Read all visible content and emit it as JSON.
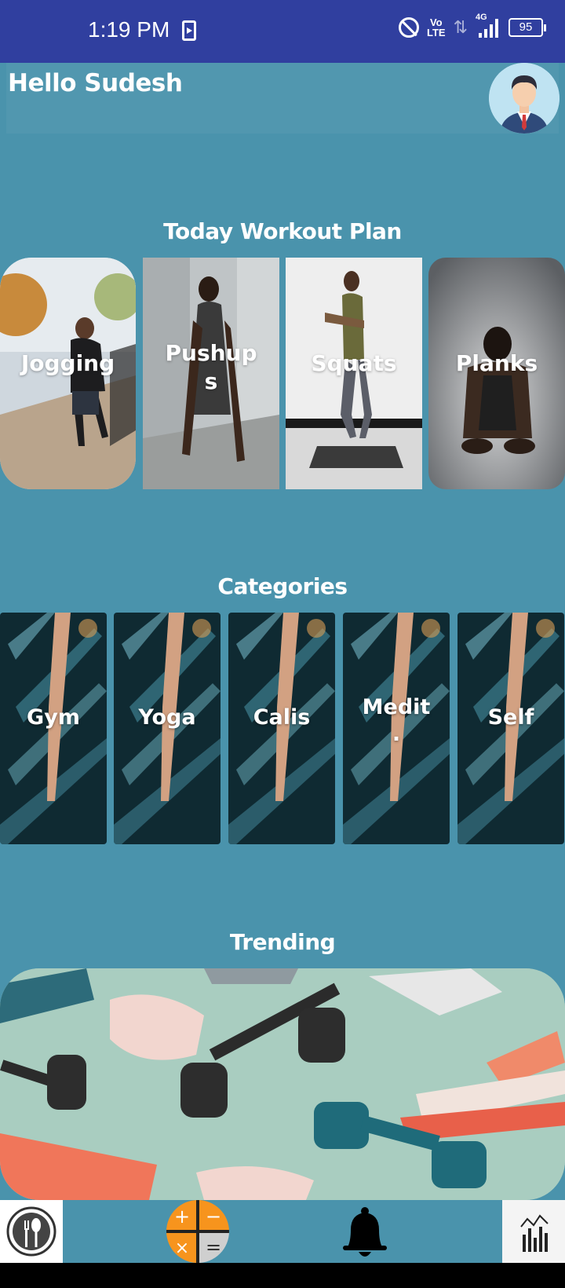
{
  "status_bar": {
    "time": "1:19 PM",
    "volte_top": "Vo",
    "volte_bottom": "LTE",
    "network": "4G",
    "battery": "95"
  },
  "header": {
    "greeting": "Hello Sudesh"
  },
  "workout_plan": {
    "title": "Today Workout Plan",
    "items": [
      {
        "label": "Jogging"
      },
      {
        "label": "Pushup\ns"
      },
      {
        "label": "Squats"
      },
      {
        "label": "Planks"
      }
    ]
  },
  "categories": {
    "title": "Categories",
    "items": [
      {
        "label": "Gym"
      },
      {
        "label": "Yoga"
      },
      {
        "label": "Calis"
      },
      {
        "label": "Medit\n."
      },
      {
        "label": "Self"
      }
    ]
  },
  "trending": {
    "title": "Trending"
  },
  "bottom_nav": {
    "items": [
      "diet-icon",
      "calculator-icon",
      "notification-bell-icon",
      "stats-chart-icon"
    ]
  }
}
